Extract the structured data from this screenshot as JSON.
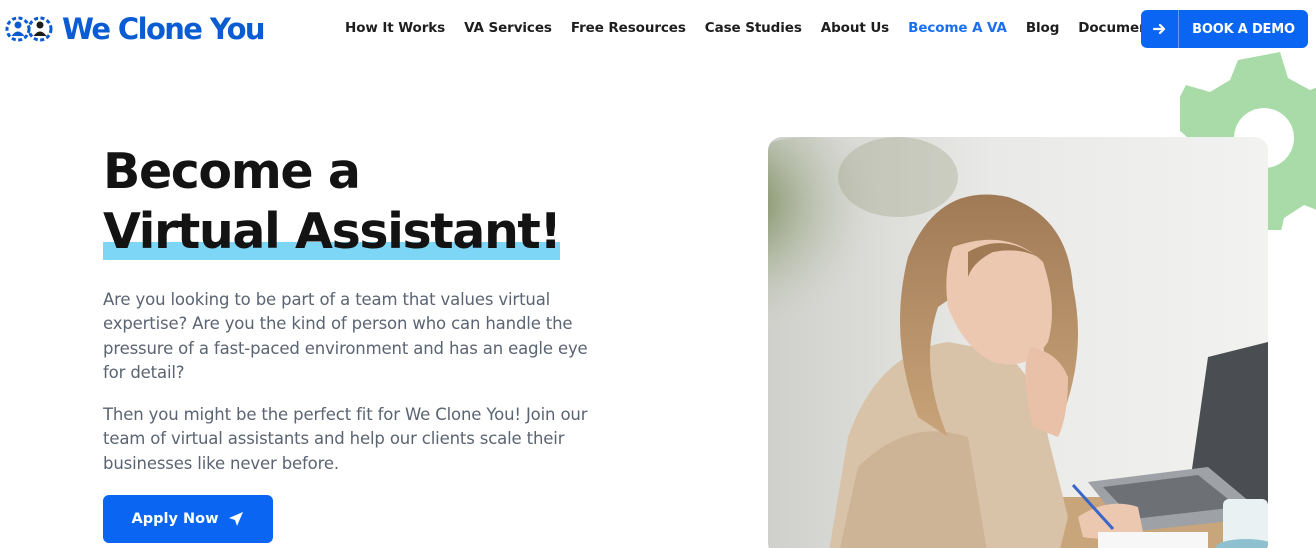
{
  "brand": {
    "name": "We Clone You",
    "logo_icon": "people-gear-icon",
    "color": "#0b5bd3"
  },
  "nav": {
    "items": [
      {
        "label": "How It Works",
        "active": false
      },
      {
        "label": "VA Services",
        "active": false
      },
      {
        "label": "Free Resources",
        "active": false
      },
      {
        "label": "Case Studies",
        "active": false
      },
      {
        "label": "About Us",
        "active": false
      },
      {
        "label": "Become A VA",
        "active": true
      },
      {
        "label": "Blog",
        "active": false
      },
      {
        "label": "Documentation",
        "active": false
      }
    ],
    "active_color": "#1a6ff0"
  },
  "cta": {
    "book_demo": "BOOK A DEMO",
    "book_demo_icon": "arrow-right-icon",
    "color": "#0a66f2"
  },
  "hero": {
    "title_line1": "Become a",
    "title_line2": "Virtual Assistant!",
    "highlight_color": "#7dd6f5",
    "paragraph1": "Are you looking to be part of a team that values virtual expertise? Are you the kind of person who can handle the pressure of a fast-paced environment and has an eagle eye for detail?",
    "paragraph2": "Then you might be the perfect fit for We Clone You! Join our team of virtual assistants and help our clients scale their businesses like never before.",
    "apply_label": "Apply Now",
    "apply_icon": "paper-plane-icon"
  },
  "decoration": {
    "gear_color": "#a9dba9"
  }
}
